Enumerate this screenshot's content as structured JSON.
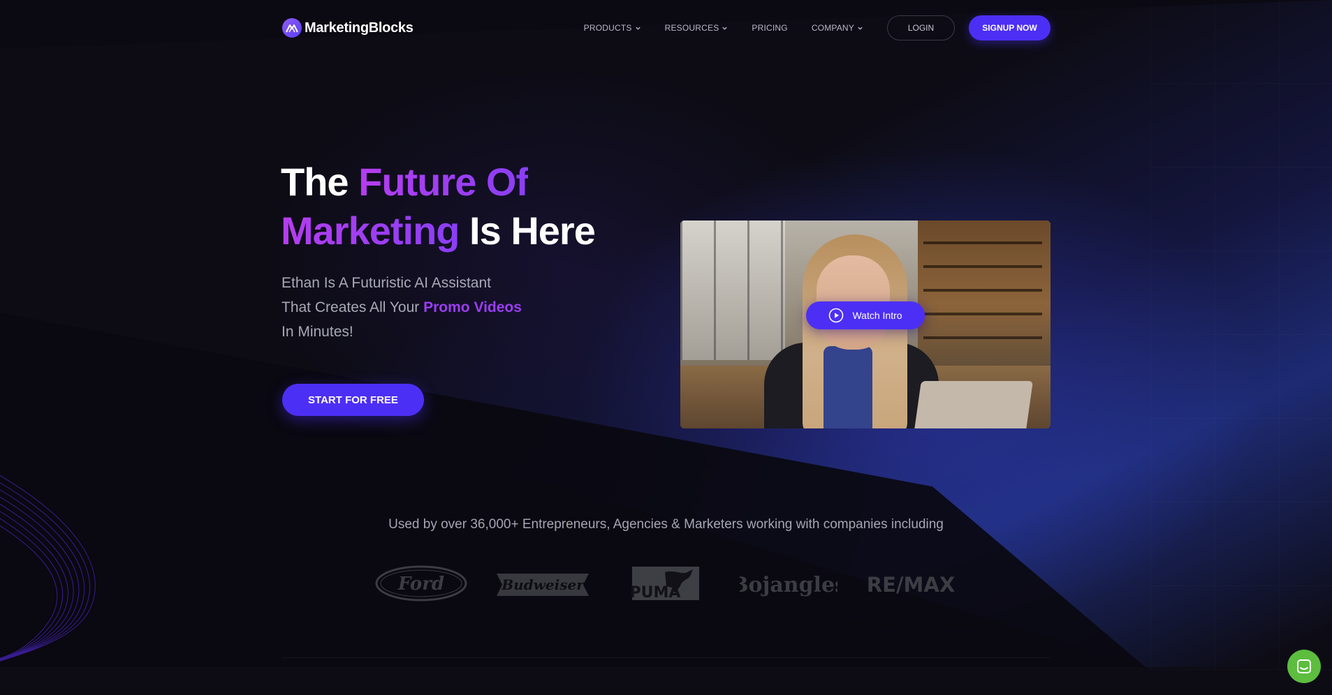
{
  "brand": {
    "name": "MarketingBlocks",
    "logo_icon": "mountain-logo-icon"
  },
  "nav": {
    "items": [
      {
        "label": "PRODUCTS",
        "has_dropdown": true
      },
      {
        "label": "RESOURCES",
        "has_dropdown": true
      },
      {
        "label": "PRICING",
        "has_dropdown": false
      },
      {
        "label": "COMPANY",
        "has_dropdown": true
      }
    ],
    "login_label": "LOGIN",
    "signup_label": "SIGNUP NOW"
  },
  "hero": {
    "title_part1": "The ",
    "title_part2": "Future Of",
    "title_part3": "Marketing",
    "title_part4": " Is Here",
    "subtitle_line1": "Ethan Is A Futuristic AI Assistant",
    "subtitle_line2_prefix": "That Creates All Your ",
    "subtitle_line2_highlight": "Promo Videos",
    "subtitle_line3": "In Minutes!",
    "cta_label": "START FOR FREE"
  },
  "video": {
    "watch_label": "Watch Intro"
  },
  "social_proof": {
    "text": "Used by over 36,000+ Entrepreneurs, Agencies & Marketers working with companies including",
    "logos": [
      "Ford",
      "Budweiser",
      "PUMA",
      "Bojangles",
      "RE/MAX"
    ]
  },
  "colors": {
    "accent": "#4c2ff5",
    "gradient_purple": "#b03cf0",
    "background": "#0d0c15",
    "chat_green": "#5cbd3e"
  }
}
